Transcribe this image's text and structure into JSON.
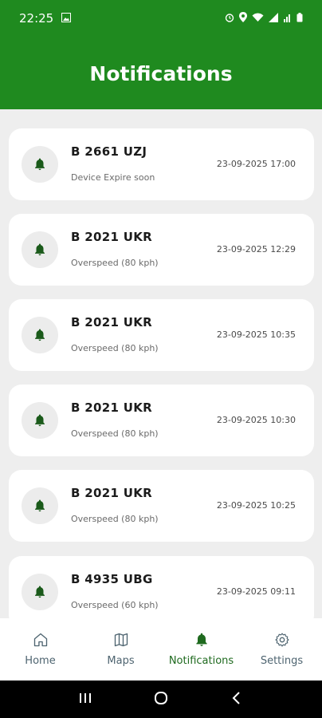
{
  "status_bar": {
    "time": "22:25"
  },
  "header": {
    "title": "Notifications"
  },
  "notifications": [
    {
      "plate": "B 2661 UZJ",
      "description": "Device Expire soon",
      "timestamp": "23-09-2025 17:00"
    },
    {
      "plate": "B 2021 UKR",
      "description": "Overspeed (80 kph)",
      "timestamp": "23-09-2025 12:29"
    },
    {
      "plate": "B 2021 UKR",
      "description": "Overspeed (80 kph)",
      "timestamp": "23-09-2025 10:35"
    },
    {
      "plate": "B 2021 UKR",
      "description": "Overspeed (80 kph)",
      "timestamp": "23-09-2025 10:30"
    },
    {
      "plate": "B 2021 UKR",
      "description": "Overspeed (80 kph)",
      "timestamp": "23-09-2025 10:25"
    },
    {
      "plate": "B 4935 UBG",
      "description": "Overspeed (60 kph)",
      "timestamp": "23-09-2025 09:11"
    }
  ],
  "bottom_nav": {
    "items": [
      {
        "label": "Home",
        "icon": "home-icon"
      },
      {
        "label": "Maps",
        "icon": "map-icon"
      },
      {
        "label": "Notifications",
        "icon": "bell-icon",
        "active": true
      },
      {
        "label": "Settings",
        "icon": "gear-icon"
      }
    ]
  },
  "colors": {
    "brand_green": "#1f8a1f",
    "bell_green": "#1a5a1a",
    "nav_inactive": "#4e6470",
    "nav_active": "#1f6a1f"
  }
}
